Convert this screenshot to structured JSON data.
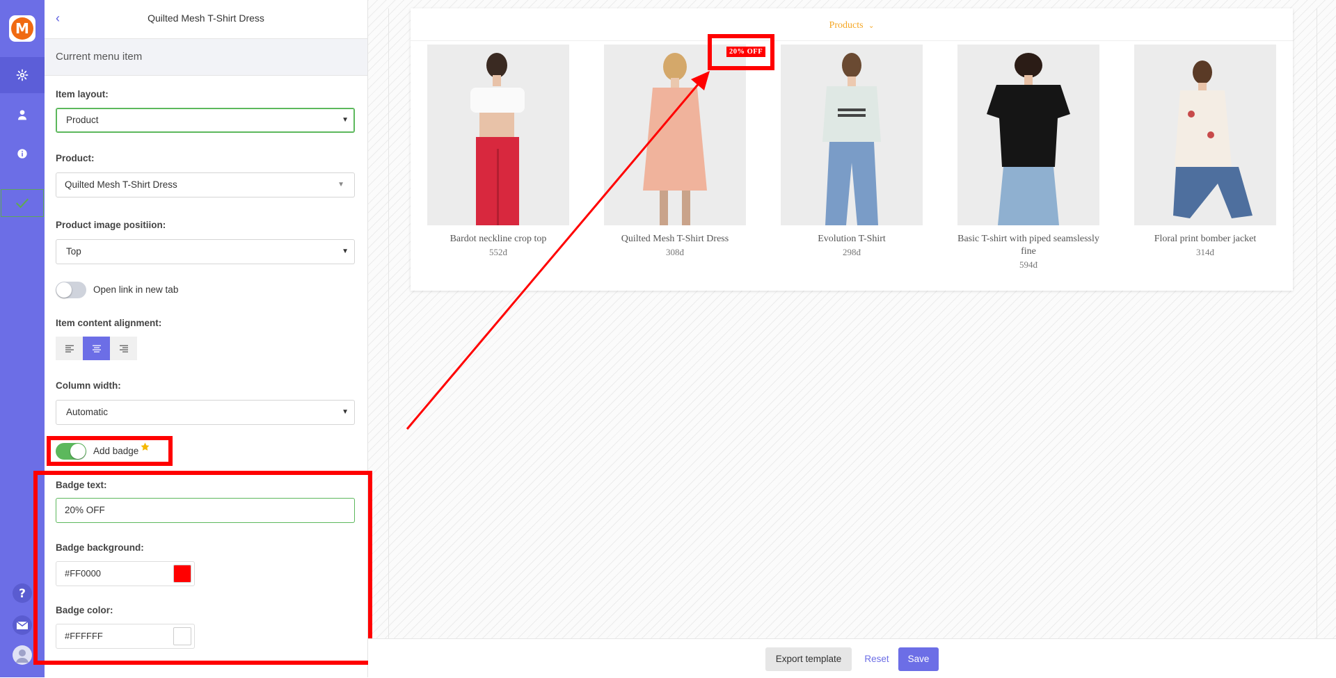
{
  "app": {
    "logo_letter": "M",
    "brand_color": "#f06a12",
    "accent": "#6c6ee6",
    "rail_icons": [
      "gear-icon",
      "user-icon",
      "info-icon",
      "check-icon",
      "help-icon",
      "mail-icon",
      "avatar-icon"
    ]
  },
  "panel": {
    "back_icon": "‹",
    "title": "Quilted Mesh T-Shirt Dress",
    "section": "Current menu item",
    "item_layout_label": "Item layout:",
    "item_layout_value": "Product",
    "product_label": "Product:",
    "product_value": "Quilted Mesh T-Shirt Dress",
    "image_position_label": "Product image positiion:",
    "image_position_value": "Top",
    "open_new_tab_label": "Open link in new tab",
    "open_new_tab_on": false,
    "alignment_label": "Item content alignment:",
    "alignment_selected": "center",
    "column_width_label": "Column width:",
    "column_width_value": "Automatic",
    "add_badge_label": "Add badge",
    "add_badge_on": true,
    "badge_text_label": "Badge text:",
    "badge_text_value": "20% OFF",
    "badge_bg_label": "Badge background:",
    "badge_bg_value": "#FF0000",
    "badge_color_label": "Badge color:",
    "badge_color_value": "#FFFFFF"
  },
  "preview": {
    "menu_title": "Products",
    "badge": "20% OFF",
    "products": [
      {
        "name": "Bardot neckline crop top",
        "price": "552đ"
      },
      {
        "name": "Quilted Mesh T-Shirt Dress",
        "price": "308đ"
      },
      {
        "name": "Evolution T-Shirt",
        "price": "298đ"
      },
      {
        "name": "Basic T-shirt with piped seamslessly fine",
        "price": "594đ"
      },
      {
        "name": "Floral print bomber jacket",
        "price": "314đ"
      }
    ]
  },
  "footer": {
    "export": "Export template",
    "reset": "Reset",
    "save": "Save"
  }
}
